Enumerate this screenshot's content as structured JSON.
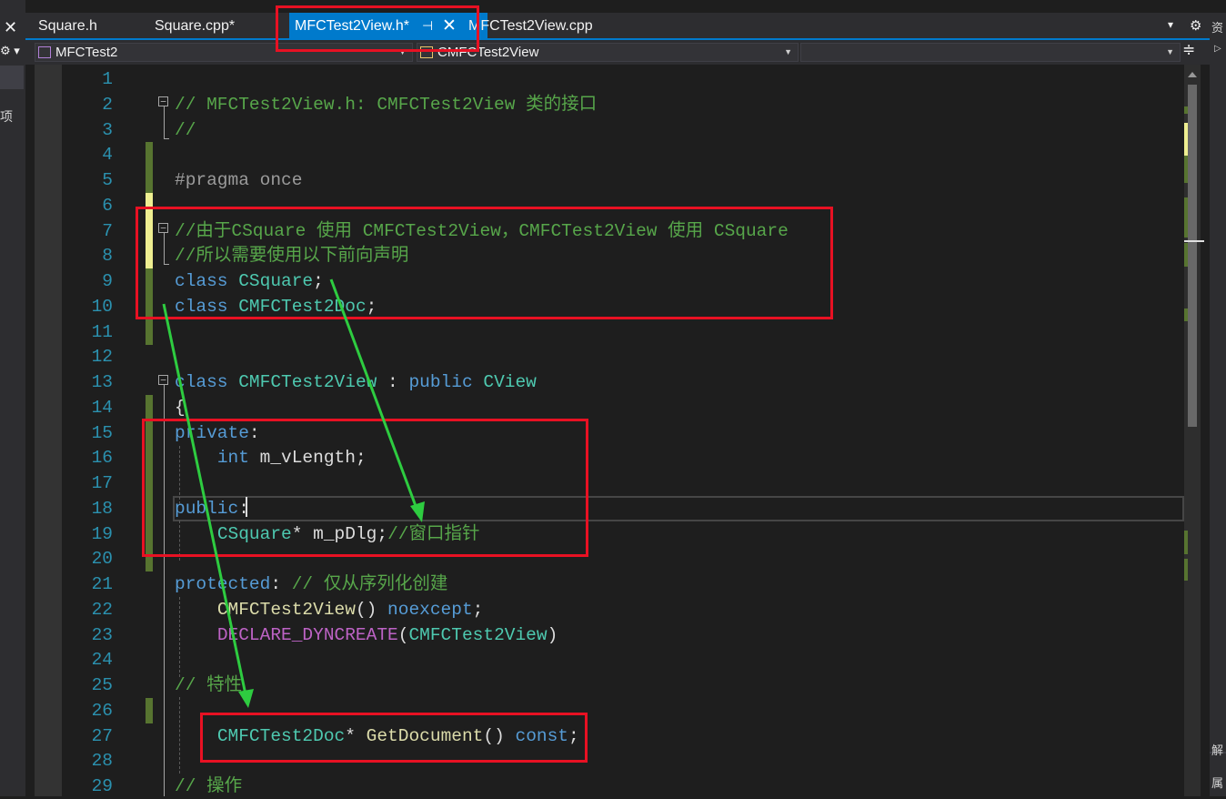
{
  "left_panel": {
    "close_glyph": "✕",
    "tool_glyph": "⚙ ▾",
    "partial_label": "项"
  },
  "tabs": [
    {
      "label": "Square.h"
    },
    {
      "label": "Square.cpp*"
    },
    {
      "label": "MFCTest2View.h*",
      "active": true
    },
    {
      "label": "MFCTest2View.cpp"
    }
  ],
  "tab_controls": {
    "pin_glyph": "⊣",
    "close_glyph": "✕",
    "dropdown_glyph": "▾",
    "settings_glyph": "⚙"
  },
  "nav": {
    "project": "MFCTest2",
    "class": "CMFCTest2View",
    "member": "",
    "split_glyph": "≑"
  },
  "right_panel": {
    "char1": "资",
    "char2": "▷",
    "char3": "解",
    "char4": "属"
  },
  "editor": {
    "line_numbers": [
      "1",
      "2",
      "3",
      "4",
      "5",
      "6",
      "7",
      "8",
      "9",
      "10",
      "11",
      "12",
      "13",
      "14",
      "15",
      "16",
      "17",
      "18",
      "19",
      "20",
      "21",
      "22",
      "23",
      "24",
      "25",
      "26",
      "27",
      "28",
      "29"
    ],
    "lines": [
      [],
      [
        {
          "t": "// MFCTest2View.h: CMFCTest2View 类的接口",
          "c": "com"
        }
      ],
      [
        {
          "t": "//",
          "c": "com"
        }
      ],
      [],
      [
        {
          "t": "#pragma once",
          "c": "pre"
        }
      ],
      [],
      [
        {
          "t": "//由于CSquare 使用 CMFCTest2View，CMFCTest2View 使用 CSquare",
          "c": "com"
        }
      ],
      [
        {
          "t": "//所以需要使用以下前向声明",
          "c": "com"
        }
      ],
      [
        {
          "t": "class ",
          "c": "kw"
        },
        {
          "t": "CSquare",
          "c": "cls"
        },
        {
          "t": ";",
          "c": "txt"
        }
      ],
      [
        {
          "t": "class ",
          "c": "kw"
        },
        {
          "t": "CMFCTest2Doc",
          "c": "cls"
        },
        {
          "t": ";",
          "c": "txt"
        }
      ],
      [],
      [],
      [
        {
          "t": "class ",
          "c": "kw"
        },
        {
          "t": "CMFCTest2View",
          "c": "cls"
        },
        {
          "t": " : ",
          "c": "txt"
        },
        {
          "t": "public ",
          "c": "kw"
        },
        {
          "t": "CView",
          "c": "cls"
        }
      ],
      [
        {
          "t": "{",
          "c": "txt"
        }
      ],
      [
        {
          "t": "private",
          "c": "kw"
        },
        {
          "t": ":",
          "c": "txt"
        }
      ],
      [
        {
          "t": "    ",
          "c": "txt"
        },
        {
          "t": "int ",
          "c": "kw"
        },
        {
          "t": "m_vLength;",
          "c": "txt"
        }
      ],
      [],
      [
        {
          "t": "public",
          "c": "kw"
        },
        {
          "t": ":",
          "c": "txt"
        }
      ],
      [
        {
          "t": "    ",
          "c": "txt"
        },
        {
          "t": "CSquare",
          "c": "cls"
        },
        {
          "t": "* m_pDlg;",
          "c": "txt"
        },
        {
          "t": "//窗口指针",
          "c": "com"
        }
      ],
      [],
      [
        {
          "t": "protected",
          "c": "kw"
        },
        {
          "t": ": ",
          "c": "txt"
        },
        {
          "t": "// 仅从序列化创建",
          "c": "com"
        }
      ],
      [
        {
          "t": "    ",
          "c": "txt"
        },
        {
          "t": "CMFCTest2View",
          "c": "fn"
        },
        {
          "t": "() ",
          "c": "txt"
        },
        {
          "t": "noexcept",
          "c": "kw"
        },
        {
          "t": ";",
          "c": "txt"
        }
      ],
      [
        {
          "t": "    ",
          "c": "txt"
        },
        {
          "t": "DECLARE_DYNCREATE",
          "c": "mac"
        },
        {
          "t": "(",
          "c": "txt"
        },
        {
          "t": "CMFCTest2View",
          "c": "cls"
        },
        {
          "t": ")",
          "c": "txt"
        }
      ],
      [],
      [
        {
          "t": "// 特性",
          "c": "com"
        }
      ],
      [],
      [
        {
          "t": "    ",
          "c": "txt"
        },
        {
          "t": "CMFCTest2Doc",
          "c": "cls"
        },
        {
          "t": "* ",
          "c": "txt"
        },
        {
          "t": "GetDocument",
          "c": "fn"
        },
        {
          "t": "() ",
          "c": "txt"
        },
        {
          "t": "const",
          "c": "kw"
        },
        {
          "t": ";",
          "c": "txt"
        }
      ],
      [],
      [
        {
          "t": "// 操作",
          "c": "com"
        }
      ]
    ],
    "change_markers": [
      {
        "line": 4,
        "state": "saved"
      },
      {
        "line": 5,
        "state": "saved"
      },
      {
        "line": 6,
        "state": "unsaved"
      },
      {
        "line": 7,
        "state": "unsaved"
      },
      {
        "line": 8,
        "state": "unsaved"
      },
      {
        "line": 9,
        "state": "saved"
      },
      {
        "line": 10,
        "state": "saved"
      },
      {
        "line": 11,
        "state": "saved"
      },
      {
        "line": 14,
        "state": "saved"
      },
      {
        "line": 15,
        "state": "saved"
      },
      {
        "line": 16,
        "state": "saved"
      },
      {
        "line": 17,
        "state": "saved"
      },
      {
        "line": 18,
        "state": "saved"
      },
      {
        "line": 19,
        "state": "saved"
      },
      {
        "line": 20,
        "state": "saved"
      },
      {
        "line": 26,
        "state": "saved"
      }
    ],
    "colors": {
      "line_number": "#2b91af",
      "comment": "#57a64a",
      "keyword": "#569cd6",
      "type": "#4ec9b0",
      "function": "#dcdcaa",
      "macro": "#bd63c5",
      "saved_change": "#577430",
      "unsaved_change": "#efef91",
      "annotation_box": "#e81123",
      "annotation_arrow": "#2ecc40",
      "accent": "#007acc"
    }
  }
}
